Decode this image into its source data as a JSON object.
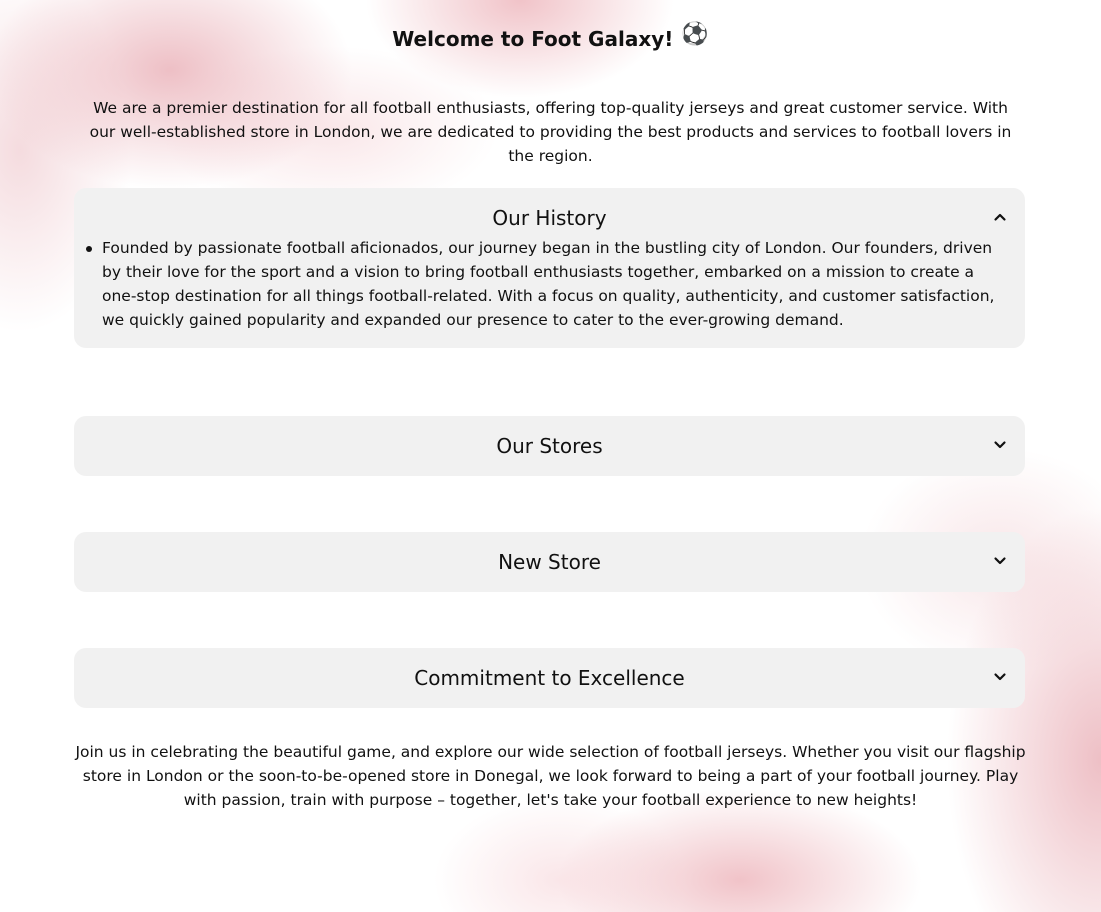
{
  "header": {
    "title": "Welcome to Foot Galaxy!",
    "title_icon": "⚽"
  },
  "intro": {
    "text": "We are a premier destination for all football enthusiasts, offering top-quality jerseys and great customer service. With our well-established store in London, we are dedicated to providing the best products and services to football lovers in the region."
  },
  "sections": [
    {
      "title": "Our History",
      "expanded": true,
      "icon": "chevron-up-icon",
      "items": [
        "Founded by passionate football aficionados, our journey began in the bustling city of London. Our founders, driven by their love for the sport and a vision to bring football enthusiasts together, embarked on a mission to create a one-stop destination for all things football-related. With a focus on quality, authenticity, and customer satisfaction, we quickly gained popularity and expanded our presence to cater to the ever-growing demand."
      ]
    },
    {
      "title": "Our Stores",
      "expanded": false,
      "icon": "chevron-down-icon"
    },
    {
      "title": "New Store",
      "expanded": false,
      "icon": "chevron-down-icon"
    },
    {
      "title": "Commitment to Excellence",
      "expanded": false,
      "icon": "chevron-down-icon"
    }
  ],
  "outro": {
    "text": "Join us in celebrating the beautiful game, and explore our wide selection of football jerseys. Whether you visit our flagship store in London or the soon-to-be-opened store in Donegal, we look forward to being a part of your football journey. Play with passion, train with purpose – together, let's take your football experience to new heights!"
  },
  "colors": {
    "panel_background": "#f1f1f1",
    "text": "#111111",
    "background_accent": "#e8aab2"
  }
}
